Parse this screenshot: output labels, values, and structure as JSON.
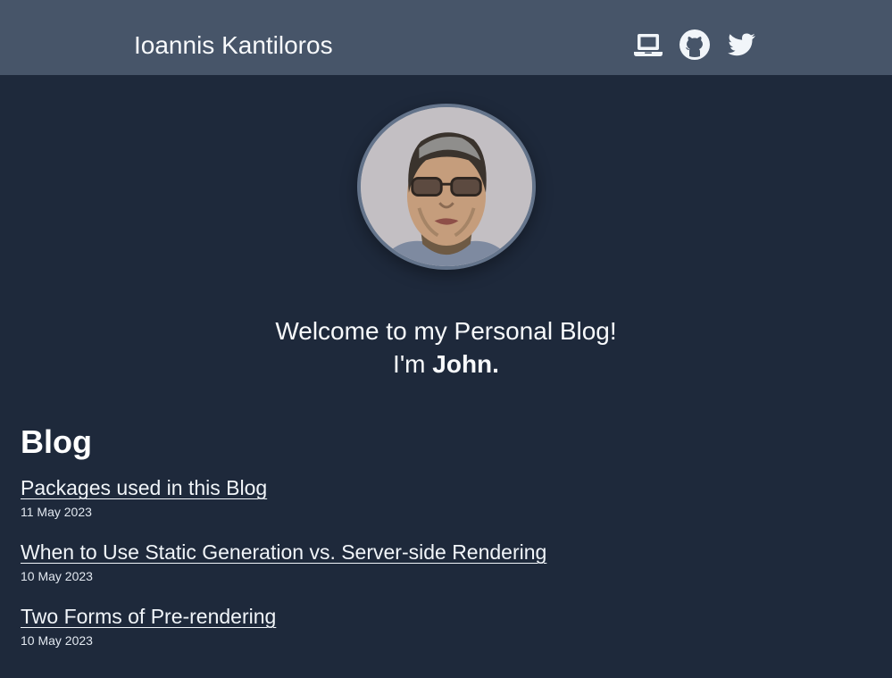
{
  "header": {
    "site_title": "Ioannis Kantiloros",
    "icons": [
      "laptop-icon",
      "github-icon",
      "twitter-icon"
    ]
  },
  "hero": {
    "welcome_line": "Welcome to my Personal Blog!",
    "intro_prefix": "I'm ",
    "name": "John."
  },
  "blog": {
    "heading": "Blog",
    "posts": [
      {
        "title": "Packages used in this Blog",
        "date": "11 May 2023"
      },
      {
        "title": "When to Use Static Generation vs. Server-side Rendering",
        "date": "10 May 2023"
      },
      {
        "title": "Two Forms of Pre-rendering",
        "date": "10 May 2023"
      }
    ]
  },
  "colors": {
    "header_bg": "#475569",
    "page_bg": "#1e293b",
    "text": "#f8fafc"
  }
}
